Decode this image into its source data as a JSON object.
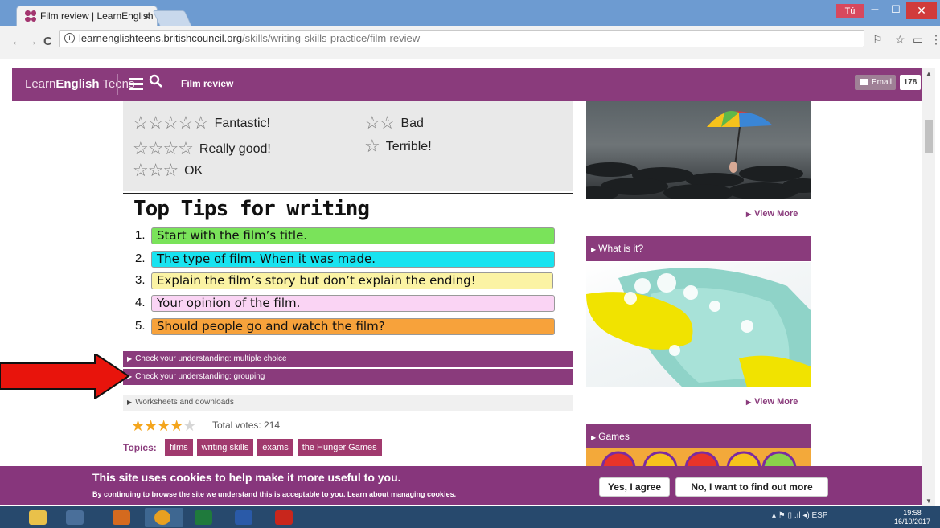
{
  "browser": {
    "tab_title": "Film review | LearnEnglish",
    "tab_close": "×",
    "window_user": "Tú",
    "window_min": "–",
    "window_max": "☐",
    "window_close": "✕",
    "url_host": "learnenglishteens.britishcouncil.org",
    "url_path": "/skills/writing-skills-practice/film-review"
  },
  "site": {
    "logo_light": "Learn",
    "logo_bold": "English",
    "logo_tail": " Teens",
    "page_title": "Film review",
    "email_label": "Email",
    "share_count": "178"
  },
  "ratings": [
    {
      "stars": "☆☆☆☆☆",
      "label": "Fantastic!"
    },
    {
      "stars": "☆☆☆☆",
      "label": "Really good!"
    },
    {
      "stars": "☆☆☆",
      "label": "OK"
    },
    {
      "stars": "☆☆",
      "label": "Bad"
    },
    {
      "stars": "☆",
      "label": "Terrible!"
    }
  ],
  "tips": {
    "heading": "Top Tips for writing",
    "items": [
      {
        "num": "1.",
        "text": "Start with the film’s title.",
        "color": "#7ae35a"
      },
      {
        "num": "2.",
        "text": "The type of film. When it was made.",
        "color": "#18e3f0"
      },
      {
        "num": "3.",
        "text": "Explain the film’s story but don’t explain the ending!",
        "color": "#fbf3a4"
      },
      {
        "num": "4.",
        "text": "Your opinion of the film.",
        "color": "#fad4f4"
      },
      {
        "num": "5.",
        "text": "Should people go and watch the film?",
        "color": "#f7a23b"
      }
    ]
  },
  "exercises": {
    "multiple_choice": "Check your understanding: multiple choice",
    "grouping": "Check your understanding: grouping",
    "worksheets": "Worksheets and downloads"
  },
  "votes": {
    "rating": 4,
    "out_of": 5,
    "text": "Total votes: 214"
  },
  "topics": {
    "label": "Topics:",
    "items": [
      "films",
      "writing skills",
      "exams",
      "the Hunger Games"
    ]
  },
  "sidebar": {
    "view_more": "View More",
    "what_is_it": "What is it?",
    "games": "Games"
  },
  "cookies": {
    "title": "This site uses cookies to help make it more useful to you.",
    "text": "By continuing to browse the site we understand this is acceptable to you. Learn about managing cookies.",
    "agree": "Yes, I agree",
    "more": "No, I want to find out more"
  },
  "taskbar": {
    "lang": "ESP",
    "time": "19:58",
    "date": "16/10/2017"
  },
  "colors": {
    "brand_purple": "#8a3b7c",
    "accent_orange": "#f4a51c",
    "arrow_red": "#e8140c"
  }
}
